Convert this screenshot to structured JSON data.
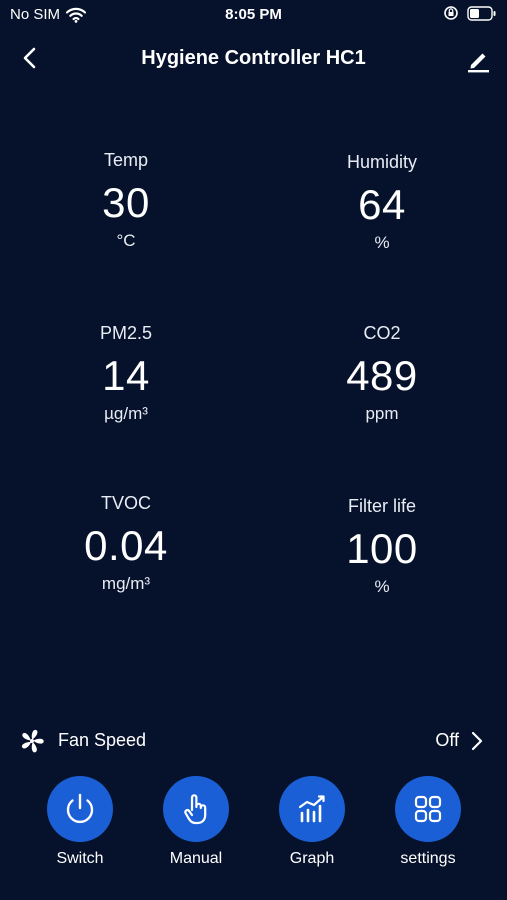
{
  "status_bar": {
    "carrier": "No SIM",
    "time": "8:05 PM"
  },
  "header": {
    "title": "Hygiene Controller HC1"
  },
  "metrics": [
    {
      "label": "Temp",
      "value": "30",
      "unit": "°C"
    },
    {
      "label": "Humidity",
      "value": "64",
      "unit": "%"
    },
    {
      "label": "PM2.5",
      "value": "14",
      "unit": "µg/m³"
    },
    {
      "label": "CO2",
      "value": "489",
      "unit": "ppm"
    },
    {
      "label": "TVOC",
      "value": "0.04",
      "unit": "mg/m³"
    },
    {
      "label": "Filter life",
      "value": "100",
      "unit": "%"
    }
  ],
  "fan": {
    "label": "Fan Speed",
    "value": "Off"
  },
  "actions": [
    {
      "label": "Switch",
      "icon": "power-icon"
    },
    {
      "label": "Manual",
      "icon": "hand-pointer-icon"
    },
    {
      "label": "Graph",
      "icon": "graph-icon"
    },
    {
      "label": "settings",
      "icon": "settings-grid-icon"
    }
  ],
  "colors": {
    "background": "#06122b",
    "accent": "#1a5fd6",
    "text": "#ffffff"
  }
}
